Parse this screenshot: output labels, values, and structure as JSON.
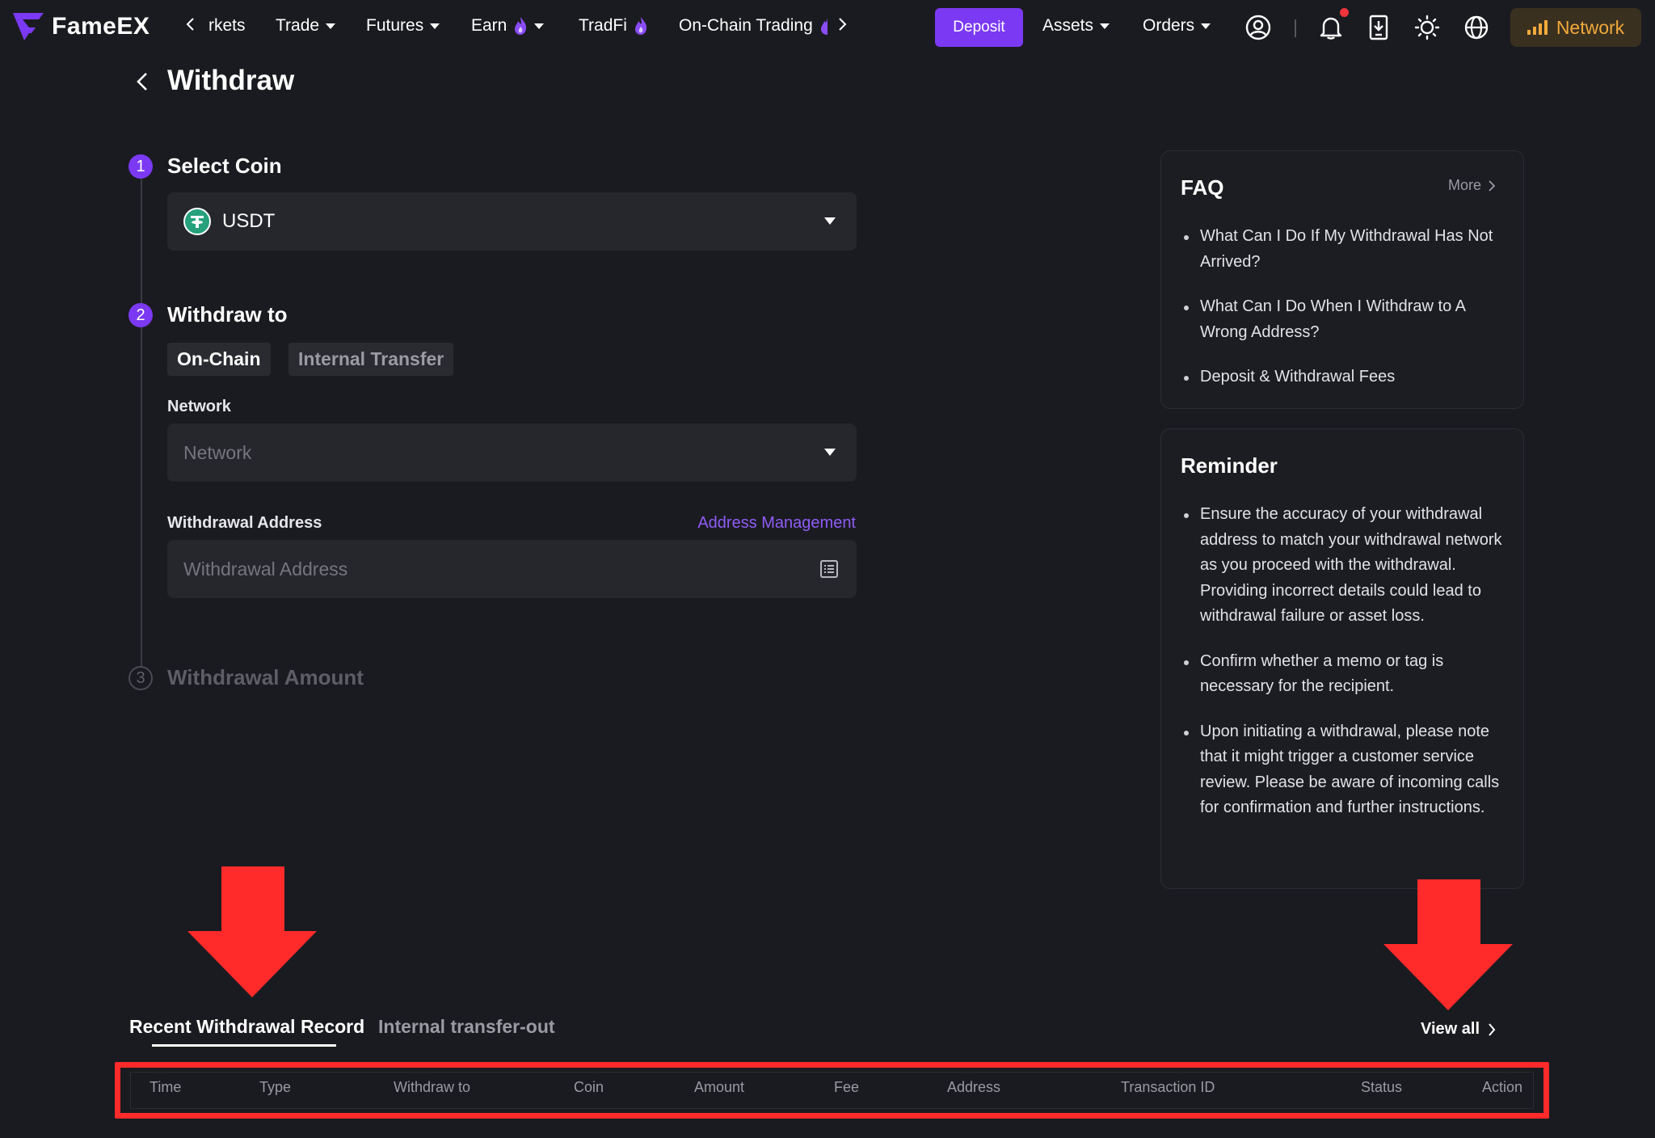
{
  "nav": {
    "brand": "FameEX",
    "items": [
      {
        "label": "rkets"
      },
      {
        "label": "Trade"
      },
      {
        "label": "Futures"
      },
      {
        "label": "Earn"
      },
      {
        "label": "TradFi"
      },
      {
        "label": "On-Chain Trading"
      }
    ],
    "deposit_label": "Deposit",
    "assets_label": "Assets",
    "orders_label": "Orders",
    "network_label": "Network"
  },
  "header": {
    "title": "Withdraw"
  },
  "steps": {
    "step1": {
      "number": "1",
      "title": "Select Coin",
      "selected_coin": "USDT"
    },
    "step2": {
      "number": "2",
      "title": "Withdraw to",
      "tabs": [
        "On-Chain",
        "Internal Transfer"
      ],
      "network_label": "Network",
      "network_placeholder": "Network",
      "address_label": "Withdrawal Address",
      "address_management": "Address Management",
      "address_placeholder": "Withdrawal Address"
    },
    "step3": {
      "number": "3",
      "title": "Withdrawal Amount"
    }
  },
  "faq": {
    "title": "FAQ",
    "more_label": "More",
    "items": [
      "What Can I Do If My Withdrawal Has Not Arrived?",
      "What Can I Do When I Withdraw to A Wrong Address?",
      "Deposit & Withdrawal Fees"
    ]
  },
  "reminder": {
    "title": "Reminder",
    "items": [
      "Ensure the accuracy of your withdrawal address to match your withdrawal network as you proceed with the withdrawal. Providing incorrect details could lead to withdrawal failure or asset loss.",
      "Confirm whether a memo or tag is necessary for the recipient.",
      "Upon initiating a withdrawal, please note that it might trigger a customer service review. Please be aware of incoming calls for confirmation and further instructions."
    ]
  },
  "records": {
    "tabs": [
      "Recent Withdrawal Record",
      "Internal transfer-out"
    ],
    "view_all_label": "View all",
    "columns": [
      "Time",
      "Type",
      "Withdraw to",
      "Coin",
      "Amount",
      "Fee",
      "Address",
      "Transaction ID",
      "Status",
      "Action"
    ]
  },
  "colors": {
    "accent": "#7b39f3",
    "background": "#1a1b20",
    "input_bg": "#26272d",
    "network_text": "#f2a93b",
    "annotation_red": "#ff2a2a",
    "link": "#8f5cf7"
  },
  "icons": [
    "fameex-logo-icon",
    "chevron-left-icon",
    "fire-icon",
    "chevron-right-icon",
    "user-circle-icon",
    "bell-icon",
    "download-app-icon",
    "sun-icon",
    "globe-icon",
    "signal-bars-icon",
    "tether-icon",
    "address-book-icon"
  ]
}
